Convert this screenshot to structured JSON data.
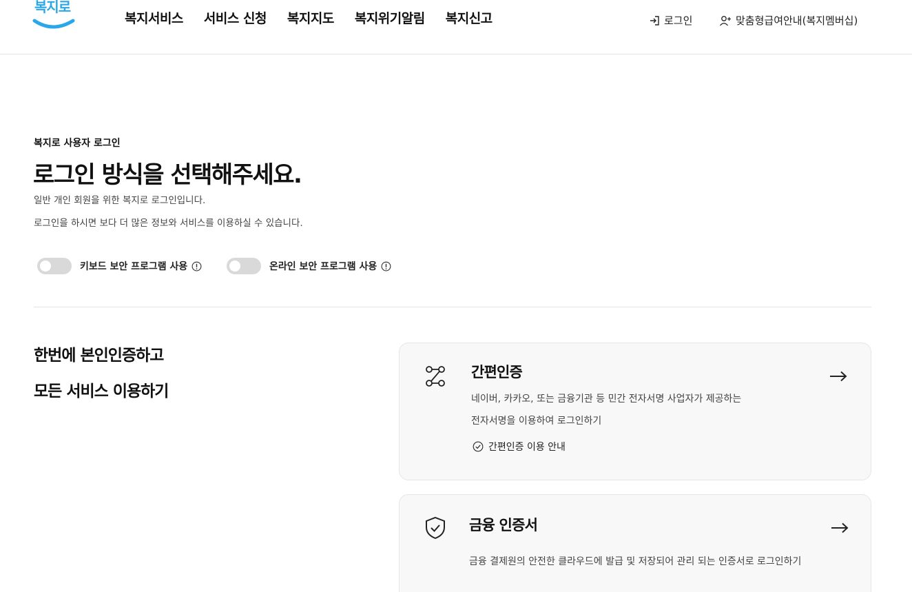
{
  "header": {
    "logo_text": "복지로",
    "nav": [
      "복지서비스",
      "서비스 신청",
      "복지지도",
      "복지위기알림",
      "복지신고"
    ],
    "login_label": "로그인",
    "member_label": "맞춤형급여안내(복지멤버십)"
  },
  "intro": {
    "eyebrow": "복지로 사용자 로그인",
    "title": "로그인 방식을 선택해주세요.",
    "desc1": "일반 개인 회원을 위한 복지로 로그인입니다.",
    "desc2": "로그인을 하시면 보다 더 많은 정보와 서비스를 이용하실 수 있습니다."
  },
  "toggles": [
    {
      "label": "키보드 보안 프로그램 사용",
      "on": false
    },
    {
      "label": "온라인 보안 프로그램 사용",
      "on": false
    }
  ],
  "left": {
    "line1": "한번에 본인인증하고",
    "line2": "모든 서비스 이용하기"
  },
  "cards": [
    {
      "title": "간편인증",
      "desc1": "네이버, 카카오, 또는 금융기관 등 민간 전자서명 사업자가 제공하는",
      "desc2": "전자서명을 이용하여 로그인하기",
      "guide": "간편인증 이용 안내",
      "icon": "route-icon"
    },
    {
      "title": "금융 인증서",
      "desc1": "금융 결제원의 안전한 클라우드에 발급 및 저장되어 관리 되는 인증서로 로그인하기",
      "icon": "shield-check-icon"
    }
  ],
  "colors": {
    "brand": "#2aa7e8",
    "toggle_off": "#d9d9d9",
    "card_bg": "#f8f8f8"
  }
}
